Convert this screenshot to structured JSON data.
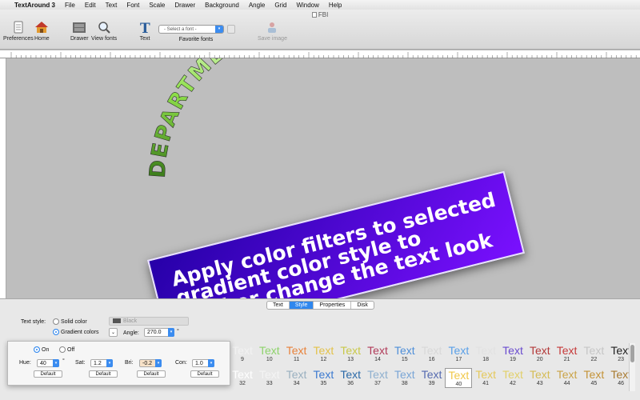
{
  "menubar": {
    "app_name": "TextAround 3",
    "items": [
      "File",
      "Edit",
      "Text",
      "Font",
      "Scale",
      "Drawer",
      "Background",
      "Angle",
      "Grid",
      "Window",
      "Help"
    ]
  },
  "window": {
    "title": "FBI"
  },
  "toolbar": {
    "preferences": "Preferences",
    "home": "Home",
    "drawer": "Drawer",
    "view_fonts": "View fonts",
    "text": "Text",
    "font_placeholder": "- Select a font -",
    "favorite_fonts": "Favorite fonts",
    "save_image": "Save image"
  },
  "canvas": {
    "curved_text": "DEPARTMENT OF JUSTICE",
    "banner_text": "Apply color filters to selected gradient color style to further change the text look"
  },
  "tabs": [
    "Text",
    "Style",
    "Properties",
    "Disk"
  ],
  "active_tab": "Style",
  "style_panel": {
    "text_style_label": "Text style:",
    "solid_color": "Solid color",
    "solid_color_value": "Black",
    "gradient_colors": "Gradient colors",
    "angle_label": "Angle:",
    "angle_value": "270.0",
    "degree": "°"
  },
  "filters": {
    "on": "On",
    "off": "Off",
    "hue_label": "Hue:",
    "hue_value": "40",
    "hue_unit": "°",
    "sat_label": "Sat:",
    "sat_value": "1.2",
    "bri_label": "Bri:",
    "bri_value": "-0.2",
    "con_label": "Con:",
    "con_value": "1.0",
    "default": "Default"
  },
  "gradient_grid": {
    "sample_text": "Text",
    "row1_numbers": [
      "9",
      "10",
      "11",
      "12",
      "13",
      "14",
      "15",
      "16",
      "17",
      "18",
      "19",
      "20",
      "21",
      "22",
      "23"
    ],
    "row2_numbers": [
      "32",
      "33",
      "34",
      "35",
      "36",
      "37",
      "38",
      "39",
      "40",
      "41",
      "42",
      "43",
      "44",
      "45",
      "46"
    ],
    "selected": "40",
    "row1_colors": [
      "#f2f2f2",
      "#8ed36b",
      "#e8823b",
      "#e3c24a",
      "#c9c94a",
      "#b13c5a",
      "#4f8fd9",
      "#d8d8d8",
      "#5aa0e8",
      "#e2e2e2",
      "#6a4ccf",
      "#b33a3a",
      "#c63a3a",
      "#c6c6c6",
      "#222222"
    ],
    "row2_colors": [
      "#ffffff",
      "#f4f4f4",
      "#9ab0c0",
      "#3c7ad0",
      "#2c6aa8",
      "#8fb0cf",
      "#7aa6d6",
      "#556ab0",
      "#f0c84a",
      "#e5c95c",
      "#e2d06a",
      "#d5bc55",
      "#caa448",
      "#c49338",
      "#a87a30"
    ]
  }
}
